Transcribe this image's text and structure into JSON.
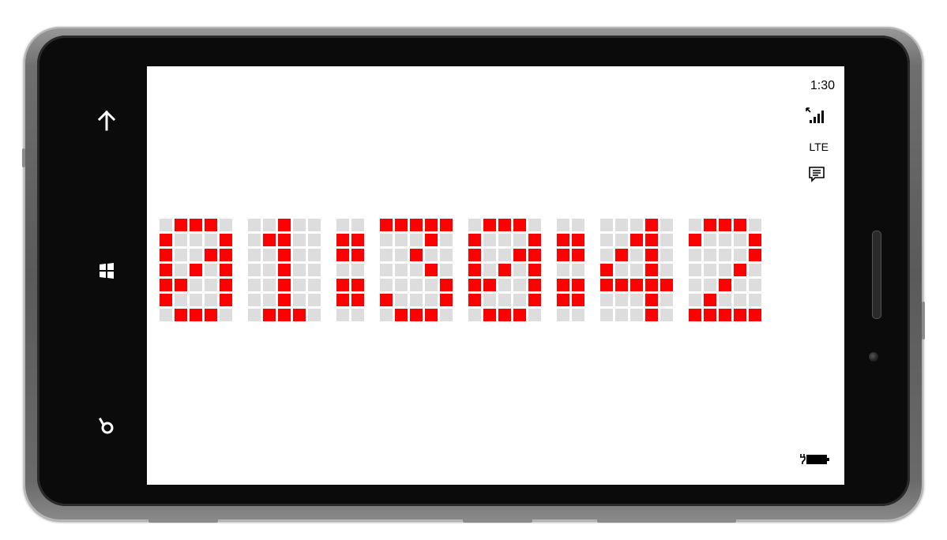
{
  "status_bar": {
    "time": "1:30",
    "network": "LTE",
    "icons": [
      "signal-bars-icon",
      "message-icon",
      "battery-charging-icon"
    ]
  },
  "clock": {
    "display": "01:30:42",
    "on_color": "#ff0000",
    "off_color": "#dddddd",
    "glyphs": [
      {
        "char": "0",
        "rows": [
          "01110",
          "10001",
          "10011",
          "10101",
          "11001",
          "10001",
          "01110"
        ]
      },
      {
        "char": "1",
        "rows": [
          "00100",
          "01100",
          "00100",
          "00100",
          "00100",
          "00100",
          "01110"
        ]
      },
      {
        "char": ":",
        "rows": [
          "00",
          "11",
          "11",
          "00",
          "11",
          "11",
          "00"
        ]
      },
      {
        "char": "3",
        "rows": [
          "11111",
          "00010",
          "00100",
          "00010",
          "00001",
          "10001",
          "01110"
        ]
      },
      {
        "char": "0",
        "rows": [
          "01110",
          "10001",
          "10011",
          "10101",
          "11001",
          "10001",
          "01110"
        ]
      },
      {
        "char": ":",
        "rows": [
          "00",
          "11",
          "11",
          "00",
          "11",
          "11",
          "00"
        ]
      },
      {
        "char": "4",
        "rows": [
          "00010",
          "00110",
          "01010",
          "10010",
          "11111",
          "00010",
          "00010"
        ]
      },
      {
        "char": "2",
        "rows": [
          "01110",
          "10001",
          "00001",
          "00010",
          "00100",
          "01000",
          "11111"
        ]
      }
    ]
  },
  "nav": {
    "buttons": [
      "back-icon",
      "windows-start-icon",
      "search-icon"
    ]
  }
}
